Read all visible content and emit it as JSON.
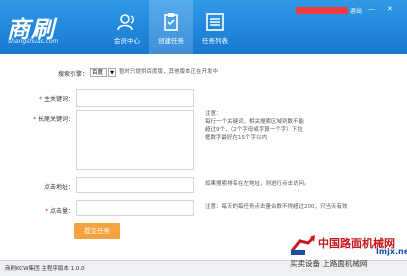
{
  "header": {
    "logo_text": "商刷",
    "logo_sub": "shangshuas.com",
    "nav": [
      {
        "label": "会员中心",
        "icon": "user-icon"
      },
      {
        "label": "创建任务",
        "icon": "clipboard-icon"
      },
      {
        "label": "任务列表",
        "icon": "list-icon"
      }
    ],
    "logout": "退出",
    "minimize": "—",
    "close": "✕"
  },
  "form": {
    "engine_label": "搜索引擎：",
    "engine_value": "百度",
    "engine_note": "暂时只提供百度版，其他版本正在开发中",
    "main_kw_label": "主关键词：",
    "long_kw_label": "长尾关键词：",
    "long_kw_note": "注意：\n每行一个关键词，相关搜索区域到数不能超过9个，（2个字母或字算一个字）下拉框数字最好在15个字以内",
    "url_label": "点击地址：",
    "url_note": "如果搜索排名在左地址，则进行点击访问。",
    "clicks_label": "点击量：",
    "clicks_note": "注意：每天的每任务点击量合数不得超过200，只当天有效",
    "submit": "提交任务"
  },
  "footer": {
    "text": "商刷KCW集团 主程序版本 1.0.0"
  },
  "watermark": {
    "cn": "中国路面机械网",
    "en": "lmjx.net",
    "slogan": "买卖设备 上路面机械网"
  },
  "colors": {
    "header": "#1f88dc",
    "accent": "#f4a340",
    "danger": "#c8161d"
  }
}
